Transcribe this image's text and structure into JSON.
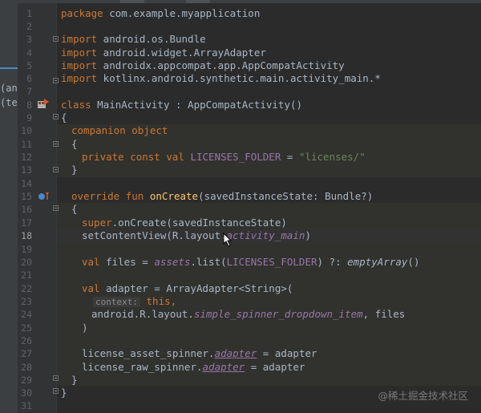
{
  "sidebar": {
    "fragments": [
      "(and",
      "(tes"
    ]
  },
  "editor": {
    "current_line": "18",
    "lines": [
      {
        "n": "1",
        "text": "package com.example.myapplication"
      },
      {
        "n": "2",
        "text": ""
      },
      {
        "n": "3",
        "text": "import android.os.Bundle"
      },
      {
        "n": "4",
        "text": "import android.widget.ArrayAdapter"
      },
      {
        "n": "5",
        "text": "import androidx.appcompat.app.AppCompatActivity"
      },
      {
        "n": "6",
        "text": "import kotlinx.android.synthetic.main.activity_main.*"
      },
      {
        "n": "7",
        "text": ""
      },
      {
        "n": "8",
        "text": "class MainActivity : AppCompatActivity()"
      },
      {
        "n": "9",
        "text": "{"
      },
      {
        "n": "10",
        "text": "companion object"
      },
      {
        "n": "11",
        "text": "{"
      },
      {
        "n": "12",
        "text": "private const val LICENSES_FOLDER = \"licenses/\""
      },
      {
        "n": "13",
        "text": "}"
      },
      {
        "n": "14",
        "text": ""
      },
      {
        "n": "15",
        "text": "override fun onCreate(savedInstanceState: Bundle?)"
      },
      {
        "n": "16",
        "text": "{"
      },
      {
        "n": "17",
        "text": "super.onCreate(savedInstanceState)"
      },
      {
        "n": "18",
        "text": "setContentView(R.layout.activity_main)"
      },
      {
        "n": "19",
        "text": ""
      },
      {
        "n": "20",
        "text": "val files = assets.list(LICENSES_FOLDER) ?: emptyArray()"
      },
      {
        "n": "21",
        "text": ""
      },
      {
        "n": "22",
        "text": "val adapter = ArrayAdapter<String>("
      },
      {
        "n": "23",
        "text": "context: this,"
      },
      {
        "n": "24",
        "text": "android.R.layout.simple_spinner_dropdown_item, files"
      },
      {
        "n": "25",
        "text": ")"
      },
      {
        "n": "26",
        "text": ""
      },
      {
        "n": "27",
        "text": "license_asset_spinner.adapter = adapter"
      },
      {
        "n": "28",
        "text": "license_raw_spinner.adapter = adapter"
      },
      {
        "n": "29",
        "text": "}"
      },
      {
        "n": "30",
        "text": "}"
      },
      {
        "n": "31",
        "text": ""
      }
    ]
  },
  "tokens": {
    "package": "package",
    "com_example": " com.example.myapplication",
    "import": "import",
    "imp3": " android.os.Bundle",
    "imp4": " android.widget.ArrayAdapter",
    "imp5": " androidx.appcompat.app.AppCompatActivity",
    "imp6": " kotlinx.android.synthetic.main.activity_main.*",
    "class": "class",
    "class_rest": " MainActivity : AppCompatActivity()",
    "brace_open": "{",
    "brace_close": "}",
    "companion": "companion object",
    "private_const_val": "private const val",
    "licenses_folder": "LICENSES_FOLDER",
    "eq": " = ",
    "licenses_str": "\"licenses/\"",
    "override_fun": "override fun",
    "onCreate": "onCreate",
    "oncreate_params": "(savedInstanceState: Bundle?)",
    "super": "super",
    "super_rest": ".onCreate(savedInstanceState)",
    "setcontent_a": "setContentView(R.layout.",
    "activity_main": "activity_main",
    "paren_close": ")",
    "val": "val",
    "files_a": " files = ",
    "assets": "assets",
    "list_a": ".list(",
    "elvis": ") ?: ",
    "emptyArray": "emptyArray",
    "call_close": "()",
    "adapter_decl": " adapter = ArrayAdapter<String>(",
    "context_hint": "context:",
    "this": "this,",
    "android_r_layout": "android.R.layout.",
    "spinner_item": "simple_spinner_dropdown_item",
    "files_tail": ", files",
    "asset_spinner": "license_asset_spinner.",
    "adapter_prop": "adapter",
    "assign_adapter": " = adapter",
    "raw_spinner": "license_raw_spinner."
  },
  "watermark": "@稀土掘金技术社区",
  "colors": {
    "background": "#2b2b2b",
    "keyword": "#cc7832",
    "string": "#6a8759",
    "constant": "#9876aa",
    "function": "#ffc66d",
    "text": "#a9b7c6"
  }
}
